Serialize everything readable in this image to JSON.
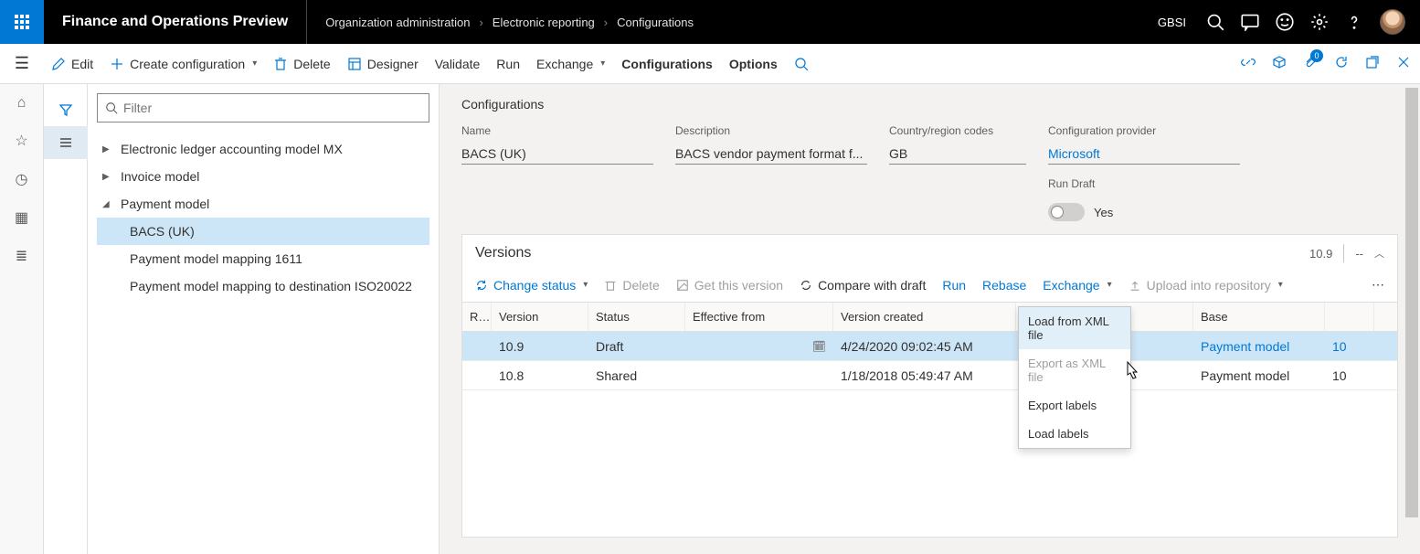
{
  "header": {
    "appTitle": "Finance and Operations Preview",
    "breadcrumb": [
      "Organization administration",
      "Electronic reporting",
      "Configurations"
    ],
    "company": "GBSI"
  },
  "actionbar": {
    "edit": "Edit",
    "create": "Create configuration",
    "delete": "Delete",
    "designer": "Designer",
    "validate": "Validate",
    "run": "Run",
    "exchange": "Exchange",
    "configurations": "Configurations",
    "options": "Options",
    "badgeCount": "0"
  },
  "tree": {
    "filterPlaceholder": "Filter",
    "items": [
      {
        "label": "Electronic ledger accounting model MX"
      },
      {
        "label": "Invoice model"
      },
      {
        "label": "Payment model"
      },
      {
        "label": "BACS (UK)"
      },
      {
        "label": "Payment model mapping 1611"
      },
      {
        "label": "Payment model mapping to destination ISO20022"
      }
    ]
  },
  "details": {
    "sectionTitle": "Configurations",
    "nameLabel": "Name",
    "nameVal": "BACS (UK)",
    "descLabel": "Description",
    "descVal": "BACS vendor payment format f...",
    "countryLabel": "Country/region codes",
    "countryVal": "GB",
    "providerLabel": "Configuration provider",
    "providerVal": "Microsoft",
    "runDraftLabel": "Run Draft",
    "runDraftVal": "Yes"
  },
  "versions": {
    "title": "Versions",
    "currentVersion": "10.9",
    "dash": "--",
    "toolbar": {
      "changeStatus": "Change status",
      "delete": "Delete",
      "getVersion": "Get this version",
      "compare": "Compare with draft",
      "run": "Run",
      "rebase": "Rebase",
      "exchange": "Exchange",
      "upload": "Upload into repository"
    },
    "columns": {
      "r": "R...",
      "version": "Version",
      "status": "Status",
      "effective": "Effective from",
      "created": "Version created",
      "conf": "",
      "base": "Base",
      "baseV": ""
    },
    "rows": [
      {
        "version": "10.9",
        "status": "Draft",
        "effective": "",
        "created": "4/24/2020 09:02:45 AM",
        "base": "Payment model",
        "baseV": "10"
      },
      {
        "version": "10.8",
        "status": "Shared",
        "effective": "",
        "created": "1/18/2018 05:49:47 AM",
        "base": "Payment model",
        "baseV": "10"
      }
    ],
    "dropdown": {
      "loadXml": "Load from XML file",
      "exportXml": "Export as XML file",
      "exportLabels": "Export labels",
      "loadLabels": "Load labels"
    }
  }
}
